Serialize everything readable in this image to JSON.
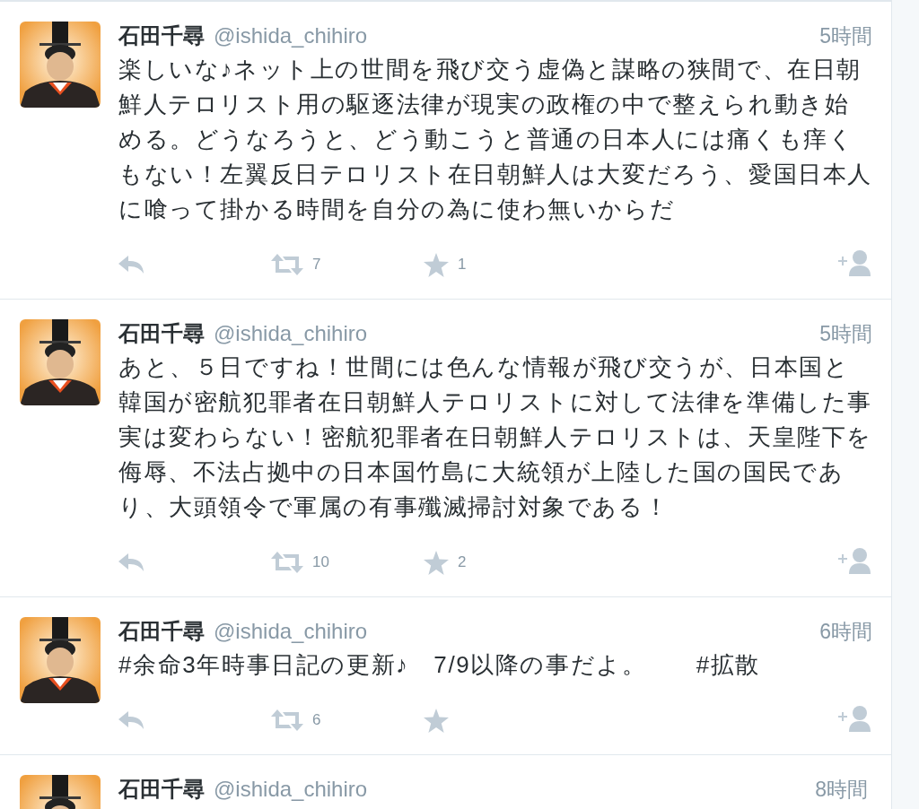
{
  "tweets": [
    {
      "name": "石田千尋",
      "handle": "@ishida_chihiro",
      "time": "5時間",
      "text": "楽しいな♪ネット上の世間を飛び交う虚偽と謀略の狭間で、在日朝鮮人テロリスト用の駆逐法律が現実の政権の中で整えられ動き始める。どうなろうと、どう動こうと普通の日本人には痛くも痒くもない！左翼反日テロリスト在日朝鮮人は大変だろう、愛国日本人に喰って掛かる時間を自分の為に使わ無いからだ",
      "actions": {
        "retweets": "7",
        "favorites": "1"
      }
    },
    {
      "name": "石田千尋",
      "handle": "@ishida_chihiro",
      "time": "5時間",
      "text": "あと、５日ですね！世間には色んな情報が飛び交うが、日本国と韓国が密航犯罪者在日朝鮮人テロリストに対して法律を準備した事実は変わらない！密航犯罪者在日朝鮮人テロリストは、天皇陛下を侮辱、不法占拠中の日本国竹島に大統領が上陸した国の国民であり、大頭領令で軍属の有事殲滅掃討対象である！",
      "actions": {
        "retweets": "10",
        "favorites": "2"
      }
    },
    {
      "name": "石田千尋",
      "handle": "@ishida_chihiro",
      "time": "6時間",
      "text": "#余命3年時事日記の更新♪　7/9以降の事だよ。　　#拡散",
      "actions": {
        "retweets": "6"
      }
    },
    {
      "name": "石田千尋",
      "handle": "@ishida_chihiro",
      "time": "8時間"
    }
  ]
}
